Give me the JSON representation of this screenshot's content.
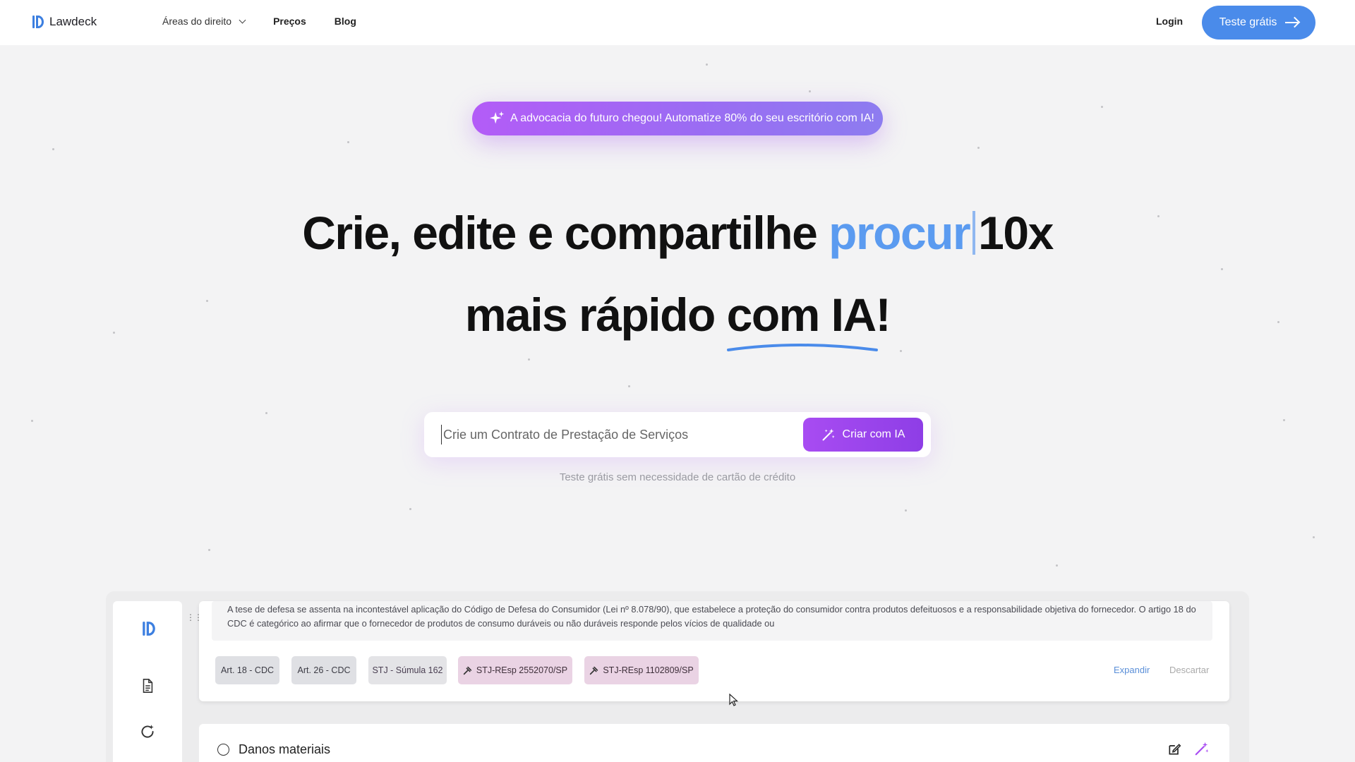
{
  "header": {
    "logo_text": "Lawdeck",
    "nav": [
      {
        "label": "Áreas do direito",
        "has_dropdown": true
      },
      {
        "label": "Preços"
      },
      {
        "label": "Blog"
      }
    ],
    "login_label": "Login",
    "cta_label": "Teste grátis"
  },
  "announcement": {
    "text": "A advocacia do futuro chegou! Automatize 80% do seu escritório com IA!",
    "icon": "sparkles-icon"
  },
  "hero": {
    "line1_prefix": "Crie, edite e compartilhe",
    "line1_typed": "procur",
    "line1_suffix": "10x",
    "line2_prefix": "mais rápido",
    "line2_highlight": "com IA!"
  },
  "search": {
    "placeholder": "Crie um Contrato de Prestação de Serviços",
    "button_label": "Criar com IA",
    "note": "Teste grátis sem necessidade de cartão de crédito"
  },
  "preview": {
    "paragraph": "A tese de defesa se assenta na incontestável aplicação do Código de Defesa do Consumidor (Lei nº 8.078/90), que estabelece a proteção do consumidor contra produtos defeituosos e a responsabilidade objetiva do fornecedor. O artigo 18 do CDC é categórico ao afirmar que o fornecedor de produtos de consumo duráveis ou não duráveis responde pelos vícios de qualidade ou",
    "chips": [
      "Art. 18 - CDC",
      "Art. 26 - CDC",
      "STJ - Súmula 162",
      "STJ-REsp 2552070/SP",
      "STJ-REsp 1102809/SP"
    ],
    "expand_label": "Expandir",
    "discard_label": "Descartar",
    "section_title": "Danos materiais"
  },
  "colors": {
    "primary_blue": "#4a8bea",
    "purple": "#a84cf2",
    "typed_text": "#5b9bf0"
  }
}
